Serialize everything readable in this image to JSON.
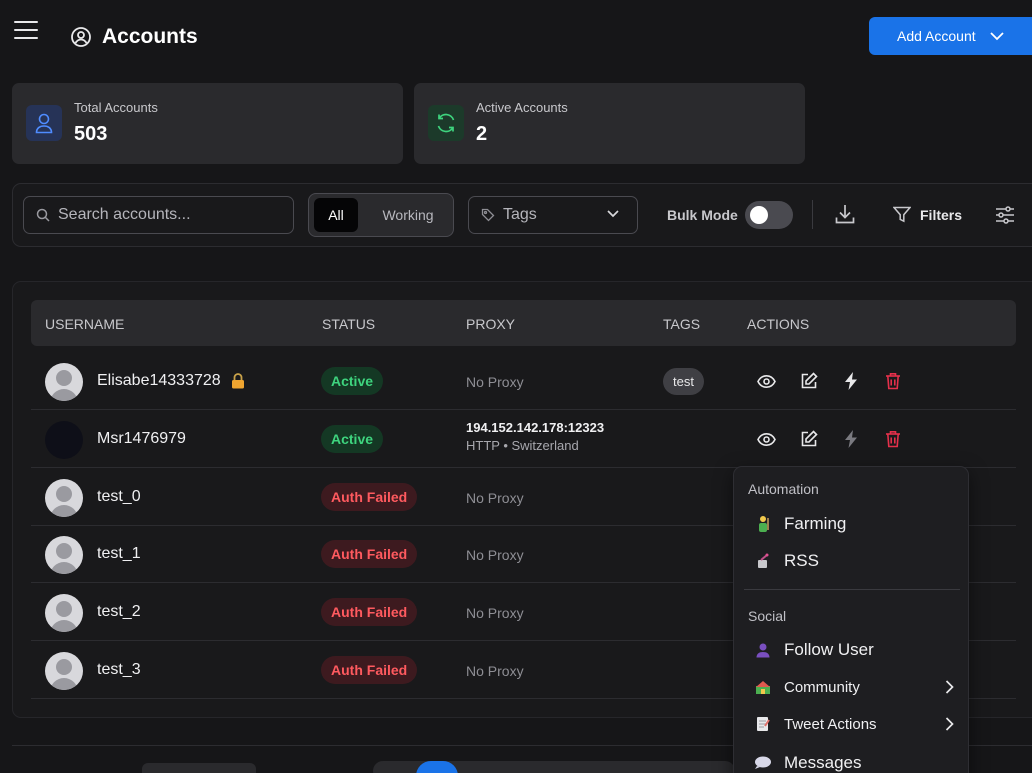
{
  "header": {
    "title": "Accounts",
    "add_button_label": "Add Account"
  },
  "stats": {
    "total": {
      "label": "Total Accounts",
      "value": "503",
      "icon": "user-icon",
      "color": "#4f8cff"
    },
    "active": {
      "label": "Active Accounts",
      "value": "2",
      "icon": "refresh-icon",
      "color": "#3ed47e"
    }
  },
  "toolbar": {
    "search_placeholder": "Search accounts...",
    "segments": {
      "all": "All",
      "working": "Working"
    },
    "tags_placeholder": "Tags",
    "bulk_mode_label": "Bulk Mode",
    "bulk_mode_on": false,
    "filters_label": "Filters"
  },
  "table": {
    "headers": {
      "username": "USERNAME",
      "status": "STATUS",
      "proxy": "PROXY",
      "tags": "TAGS",
      "actions": "ACTIONS"
    },
    "rows": [
      {
        "username": "Elisabe14333728",
        "locked": true,
        "status": "Active",
        "proxy": "No Proxy",
        "tag": "test"
      },
      {
        "username": "Msr1476979",
        "status": "Active",
        "proxy_ip": "194.152.142.178:12323",
        "proxy_type": "HTTP • Switzerland"
      },
      {
        "username": "test_0",
        "status": "Auth Failed",
        "proxy": "No Proxy"
      },
      {
        "username": "test_1",
        "status": "Auth Failed",
        "proxy": "No Proxy"
      },
      {
        "username": "test_2",
        "status": "Auth Failed",
        "proxy": "No Proxy"
      },
      {
        "username": "test_3",
        "status": "Auth Failed",
        "proxy": "No Proxy"
      }
    ]
  },
  "menu": {
    "automation_title": "Automation",
    "farming": "Farming",
    "rss": "RSS",
    "social_title": "Social",
    "follow_user": "Follow User",
    "community": "Community",
    "tweet_actions": "Tweet Actions",
    "messages": "Messages"
  },
  "colors": {
    "accent": "#1a73e8",
    "active": "#3ed47e",
    "failed": "#ff5a5f",
    "delete": "#e5304b"
  }
}
